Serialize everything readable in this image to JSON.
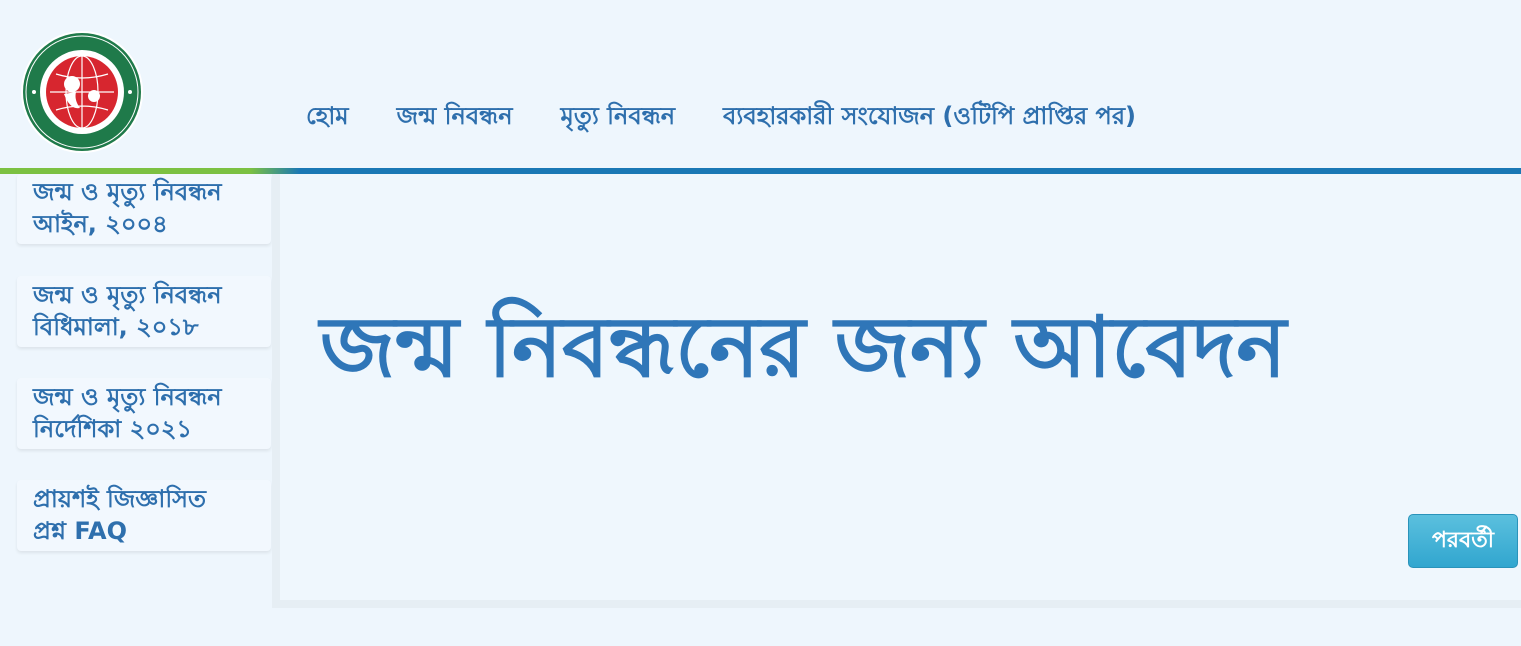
{
  "header": {
    "nav": [
      {
        "label": "হোম"
      },
      {
        "label": "জন্ম নিবন্ধন"
      },
      {
        "label": "মৃত্যু নিবন্ধন"
      },
      {
        "label": "ব্যবহারকারী সংযোজন (ওটিপি প্রাপ্তির পর)"
      }
    ]
  },
  "sidebar": {
    "items": [
      {
        "line1": "জন্ম ও মৃত্যু নিবন্ধন",
        "line2": "আইন, ২০০৪"
      },
      {
        "line1": "জন্ম ও মৃত্যু নিবন্ধন",
        "line2": "বিধিমালা, ২০১৮"
      },
      {
        "line1": "জন্ম ও মৃত্যু নিবন্ধন",
        "line2": "নির্দেশিকা ২০২১"
      },
      {
        "line1": "প্রায়শই জিজ্ঞাসিত",
        "line2": "প্রশ্ন FAQ"
      }
    ]
  },
  "main": {
    "title": "জন্ম নিবন্ধনের জন্য আবেদন",
    "next_label": "পরবর্তী"
  },
  "colors": {
    "primary_text": "#2e6fad",
    "accent_green": "#7cc142",
    "accent_blue": "#1a78b5",
    "button": "#31a6cf",
    "logo_red": "#d7262f",
    "logo_green": "#1f7a4a"
  },
  "icons": {
    "logo": "registrar-general-seal"
  }
}
